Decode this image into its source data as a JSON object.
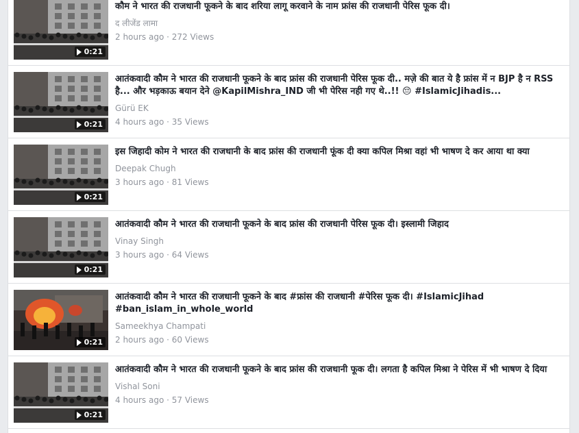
{
  "videos": [
    {
      "title": "कौम ने भारत की राजधानी फूकने के बाद शरिया लागू करवाने के नाम फ्रांस की राजधानी पेरिस फूक दी।",
      "author": "द लीजेंड लामा",
      "stats": "2 hours ago · 272 Views",
      "duration": "0:21",
      "thumb": "building"
    },
    {
      "title": "आतंकवादी कौम ने भारत की राजधानी फूकने के बाद फ्रांस की राजधानी पेरिस फूक दी.. मज़े की बात ये है फ्रांस में न BJP है न RSS है... और भड़काऊ बयान देने @KapilMishra_IND जी भी पेरिस नही गए थे..!! 😔 #IslamicJihadis...",
      "author": "Gürü EK",
      "stats": "4 hours ago · 35 Views",
      "duration": "0:21",
      "thumb": "building"
    },
    {
      "title": "इस जिहादी कोम ने भारत की राजधानी के बाद फ्रांस की राजधानी फूंक दी क्या कपिल मिश्रा वहां भी भाषण दे कर आया था क्या",
      "author": "Deepak Chugh",
      "stats": "3 hours ago · 81 Views",
      "duration": "0:21",
      "thumb": "building"
    },
    {
      "title": "आतंकवादी कौम ने भारत की राजधानी फूकने के बाद फ्रांस की राजधानी पेरिस फूक दी। इस्लामी जिहाद",
      "author": "Vinay Singh",
      "stats": "3 hours ago · 64 Views",
      "duration": "0:21",
      "thumb": "building"
    },
    {
      "title": "आतंकवादी कौम ने भारत की राजधानी फूकने के बाद #फ्रांस की राजधानी #पेरिस फूक दी। #IslamicJihad #ban_islam_in_whole_world",
      "author": "Sameekhya Champati",
      "stats": "2 hours ago · 60 Views",
      "duration": "0:21",
      "thumb": "fire"
    },
    {
      "title": "आतंकवादी कौम ने भारत की राजधानी फूकने के बाद फ्रांस की राजधानी फूक दी। लगता है कपिल मिश्रा ने पेरिस में भी भाषण दे दिया",
      "author": "Vishal Soni",
      "stats": "4 hours ago · 57 Views",
      "duration": "0:21",
      "thumb": "building"
    }
  ],
  "icons": {
    "duration": "play-icon"
  }
}
